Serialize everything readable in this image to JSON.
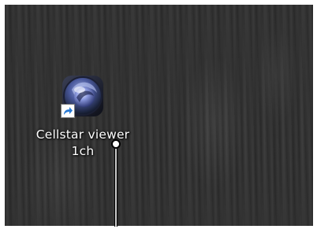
{
  "desktop": {
    "shortcut": {
      "label_line1": "Cellstar viewer",
      "label_line2": "1ch",
      "icon": "cellstar-viewer-app-icon",
      "badge_icon": "shortcut-arrow-icon"
    }
  },
  "cursor": {
    "icon": "text-cursor-icon"
  },
  "colors": {
    "desktop_wood": "#303030",
    "label_text": "#ffffff",
    "shortcut_badge": "#2a7ad4"
  }
}
